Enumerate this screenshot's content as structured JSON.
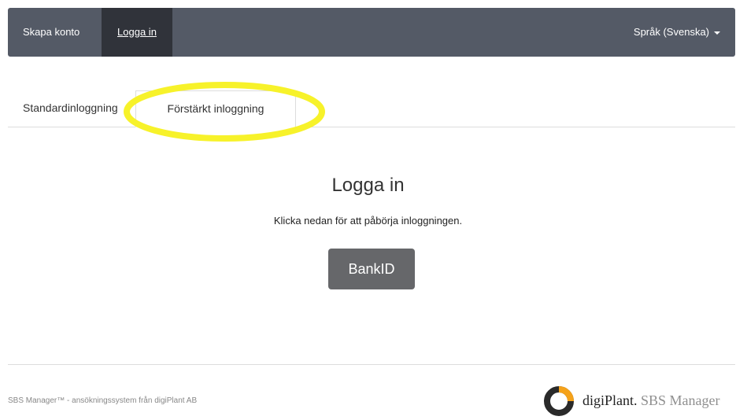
{
  "navbar": {
    "create_account": "Skapa konto",
    "login": "Logga in",
    "language": "Språk (Svenska)"
  },
  "tabs": [
    {
      "label": "Standardinloggning"
    },
    {
      "label": "Förstärkt inloggning"
    }
  ],
  "main": {
    "title": "Logga in",
    "subtitle": "Klicka nedan för att påbörja inloggningen.",
    "bankid_button": "BankID"
  },
  "footer": {
    "text": "SBS Manager™ - ansökningssystem från digiPlant AB",
    "logo_brand": "digiPlant.",
    "logo_product": "SBS Manager"
  },
  "colors": {
    "navbar": "#545a66",
    "navbar_active": "#30333a",
    "button": "#66676a",
    "highlight": "#f7f22a"
  },
  "icons": {
    "language_caret": "chevron-down-icon",
    "logo": "digiplant-ring-logo"
  }
}
